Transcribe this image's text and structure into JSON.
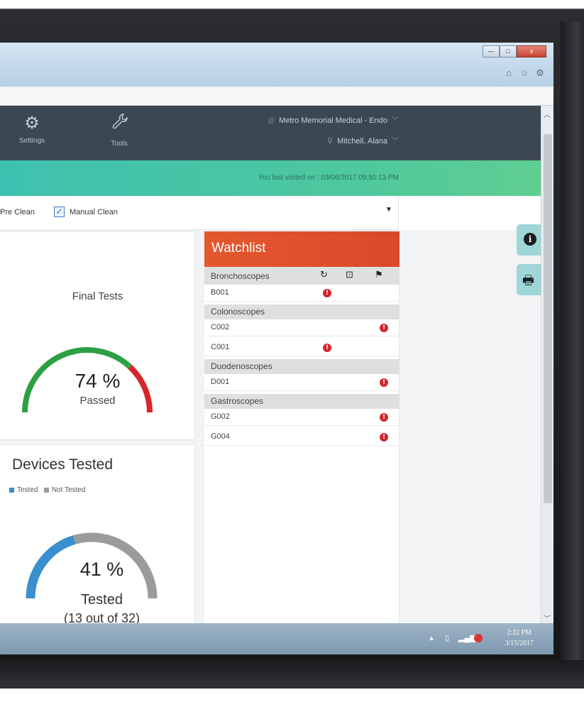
{
  "window": {
    "minimize": "—",
    "maximize": "□",
    "close": "x",
    "icons": [
      "home-icon",
      "star-icon",
      "gear-icon"
    ]
  },
  "nav": {
    "settings_label": "Settings",
    "tools_label": "Tools",
    "location": "Metro Memorial Medical - Endo",
    "user": "Mitchell, Alana"
  },
  "banner": {
    "last_visited": "You last visited on : 03/06/2017 09:50:13 PM"
  },
  "filters": {
    "pre_clean": "Pre Clean",
    "manual_clean": "Manual Clean",
    "manual_checked": true
  },
  "final_tests": {
    "title": "Final Tests",
    "percent_text": "74 %",
    "status": "Passed",
    "percent": 74,
    "colors": {
      "passed": "#2ea044",
      "failed": "#d7262b"
    }
  },
  "devices_tested": {
    "title": "Devices Tested",
    "legend_tested": "Tested",
    "legend_not_tested": "Not Tested",
    "percent_text": "41 %",
    "status": "Tested",
    "detail": "(13 out of 32)",
    "percent": 41,
    "colors": {
      "tested": "#3a8fcf",
      "not_tested": "#9b9b9b"
    }
  },
  "watchlist": {
    "title": "Watchlist",
    "groups": [
      {
        "name": "Bronchoscopes",
        "items": [
          {
            "id": "B001",
            "flag": "mid"
          }
        ]
      },
      {
        "name": "Colonoscopes",
        "items": [
          {
            "id": "C002",
            "flag": "right"
          },
          {
            "id": "C001",
            "flag": "mid"
          }
        ]
      },
      {
        "name": "Duodenoscopes",
        "items": [
          {
            "id": "D001",
            "flag": "right"
          }
        ]
      },
      {
        "name": "Gastroscopes",
        "items": [
          {
            "id": "G002",
            "flag": "right"
          },
          {
            "id": "G004",
            "flag": "right"
          }
        ]
      }
    ],
    "alert_glyph": "!"
  },
  "taskbar": {
    "time": "2:22 PM",
    "date": "3/15/2017"
  }
}
